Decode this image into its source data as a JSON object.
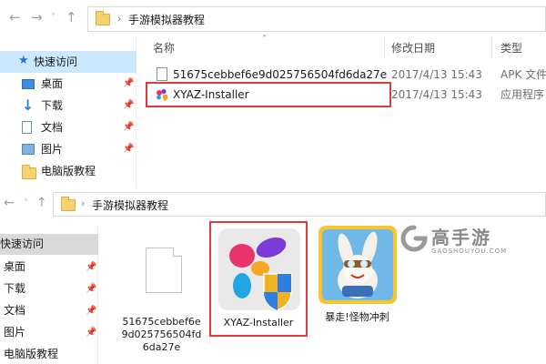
{
  "top_window": {
    "breadcrumb": {
      "folder": "手游模拟器教程"
    },
    "columns": {
      "name": "名称",
      "date": "修改日期",
      "type": "类型"
    },
    "sidebar": [
      {
        "label": "快速访问",
        "icon": "star-icon",
        "pinned": false,
        "selected": true
      },
      {
        "label": "桌面",
        "icon": "desktop-icon",
        "pinned": true
      },
      {
        "label": "下载",
        "icon": "download-icon",
        "pinned": true
      },
      {
        "label": "文档",
        "icon": "document-icon",
        "pinned": true
      },
      {
        "label": "图片",
        "icon": "picture-icon",
        "pinned": true
      },
      {
        "label": "电脑版教程",
        "icon": "folder-icon",
        "pinned": false
      }
    ],
    "files": [
      {
        "name": "51675cebbef6e9d025756504fd6da27e",
        "date": "2017/4/13 15:43",
        "type": "APK 文件",
        "icon": "file-icon"
      },
      {
        "name": "XYAZ-Installer",
        "date": "2017/4/13 15:43",
        "type": "应用程序",
        "icon": "xyaz-app-icon",
        "highlighted": true
      }
    ]
  },
  "bottom_window": {
    "breadcrumb": {
      "folder": "手游模拟器教程"
    },
    "sidebar": [
      {
        "label": "快速访问",
        "selected": true,
        "pinned": false
      },
      {
        "label": "桌面",
        "pinned": true
      },
      {
        "label": "下载",
        "pinned": true
      },
      {
        "label": "文档",
        "pinned": true
      },
      {
        "label": "图片",
        "pinned": true
      },
      {
        "label": "电脑版教程",
        "pinned": false
      }
    ],
    "tiles": [
      {
        "label": "51675cebbef6e\n9d025756504fd\n6da27e",
        "icon": "file-icon"
      },
      {
        "label": "XYAZ-Installer",
        "icon": "xyaz-app-icon",
        "highlighted": true
      },
      {
        "label": "暴走!怪物冲刺",
        "icon": "game-icon"
      }
    ]
  },
  "watermark": {
    "brand": "高手游",
    "sub": "GAOSHOUYOU.COM"
  },
  "colors": {
    "highlight": "#e23a3a",
    "selection": "#cce8ff",
    "folder": "#f5d26b"
  }
}
